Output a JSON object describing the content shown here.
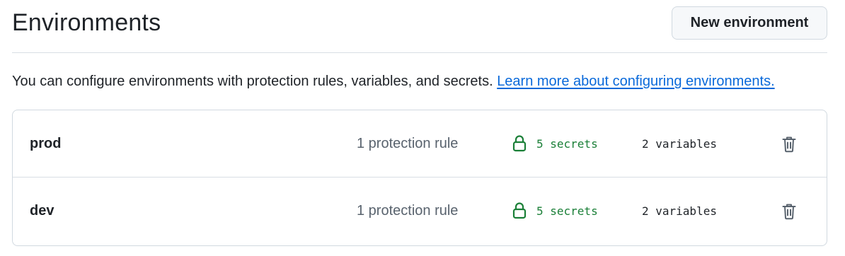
{
  "header": {
    "title": "Environments",
    "new_button_label": "New environment"
  },
  "intro": {
    "text": "You can configure environments with protection rules, variables, and secrets. ",
    "link_text": "Learn more about configuring environments."
  },
  "environments": [
    {
      "name": "prod",
      "rules": "1 protection rule",
      "secrets": "5 secrets",
      "variables": "2 variables"
    },
    {
      "name": "dev",
      "rules": "1 protection rule",
      "secrets": "5 secrets",
      "variables": "2 variables"
    }
  ],
  "icons": {
    "lock": "lock-icon",
    "delete": "trash-icon"
  },
  "colors": {
    "secrets": "#1a7f37",
    "link": "#0969da",
    "muted": "#59636e"
  }
}
